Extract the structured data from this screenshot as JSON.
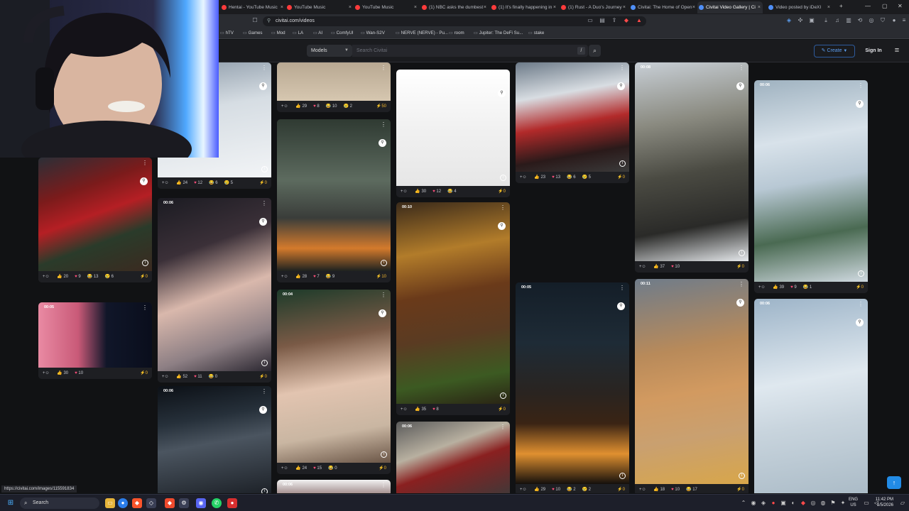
{
  "browser": {
    "tabs": [
      {
        "title": "Hentai - YouTube Music",
        "color": "#ff3b3b"
      },
      {
        "title": "YouTube Music",
        "color": "#ff3b3b"
      },
      {
        "title": "YouTube Music",
        "color": "#ff3b3b"
      },
      {
        "title": "(1) NBC asks the dumbest",
        "color": "#ff3b3b"
      },
      {
        "title": "(1) It's finally happening in",
        "color": "#ff3b3b"
      },
      {
        "title": "(1) Rust - A Duo's Journey",
        "color": "#ff3b3b"
      },
      {
        "title": "Civitai: The Home of Open",
        "color": "#4f8ff7"
      },
      {
        "title": "Civitai Video Gallery | Ci",
        "color": "#4f8ff7",
        "active": true
      },
      {
        "title": "Video posted by iDeXI",
        "color": "#4f8ff7"
      }
    ],
    "url": "civitai.com/videos",
    "bookmarks": [
      "hTV",
      "Games",
      "Mod",
      "LA",
      "AI",
      "ComfyUI",
      "Wan-S2V",
      "NERVE (NERVE) - Pu...",
      "room",
      "Jupiter: The DeFi Su...",
      "stake"
    ],
    "status_url": "https://civitai.com/images/115591834"
  },
  "site": {
    "model_select": "Models",
    "search_placeholder": "Search Civitai",
    "search_shortcut": "/",
    "create_label": "Create",
    "signin_label": "Sign In"
  },
  "cards": [
    {
      "id": "c1",
      "dur": "",
      "likes": "20",
      "hearts": "9",
      "laugh": "13",
      "cry": "6",
      "buzz": "0",
      "bg": "linear-gradient(160deg,#2b2f37 0%,#7b1b1b 30%,#b51f24 50%,#2a3b2a 70%,#3b2a20 100%)"
    },
    {
      "id": "c2",
      "dur": "00:05",
      "likes": "30",
      "hearts": "10",
      "laugh": "",
      "cry": "",
      "buzz": "0",
      "bg": "linear-gradient(90deg,#e98aa3 0%,#c95a78 35%,#101629 60%,#0a0e1c 100%)"
    },
    {
      "id": "c3",
      "dur": "",
      "likes": "24",
      "hearts": "12",
      "laugh": "6",
      "cry": "5",
      "buzz": "0",
      "bg": "linear-gradient(170deg,#8c9aa8 0%,#d6dde3 40%,#f2f4f6 100%)"
    },
    {
      "id": "c4",
      "dur": "00:06",
      "likes": "52",
      "hearts": "11",
      "laugh": "0",
      "cry": "",
      "buzz": "0",
      "bg": "linear-gradient(160deg,#1b1b22 0%,#3b3038 30%,#d9b8ac 55%,#8d7f84 80%,#2a2630 100%)"
    },
    {
      "id": "c5",
      "dur": "00:06",
      "likes": "",
      "hearts": "",
      "laugh": "",
      "cry": "",
      "buzz": "",
      "bg": "linear-gradient(170deg,#0c1016 0%,#26303a 30%,#4b5560 50%,#181c22 100%)"
    },
    {
      "id": "c6",
      "dur": "",
      "likes": "29",
      "hearts": "8",
      "laugh": "10",
      "cry": "2",
      "buzz": "50",
      "bg": "linear-gradient(180deg,#b8a892 0%,#d6c7b0 100%)"
    },
    {
      "id": "c7",
      "dur": "",
      "likes": "28",
      "hearts": "7",
      "laugh": "9",
      "cry": "",
      "buzz": "10",
      "bg": "linear-gradient(180deg,#2f3a32 0%,#5d6b5f 40%,#3a3d3a 65%,#d47a2c 85%,#1e2220 100%)"
    },
    {
      "id": "c8",
      "dur": "00:04",
      "likes": "24",
      "hearts": "15",
      "laugh": "0",
      "cry": "",
      "buzz": "0",
      "bg": "linear-gradient(170deg,#1d3b2a 0%,#7a5a46 30%,#e2c4b0 55%,#c9b6a2 80%,#6a5546 100%)"
    },
    {
      "id": "c9",
      "dur": "00:06",
      "likes": "",
      "hearts": "",
      "laugh": "",
      "cry": "",
      "buzz": "",
      "bg": "linear-gradient(180deg,#f2f2f2 0%,#7a5a5a 100%)"
    },
    {
      "id": "c10",
      "dur": "",
      "likes": "30",
      "hearts": "12",
      "laugh": "4",
      "cry": "",
      "buzz": "0",
      "bg": "linear-gradient(180deg,#ffffff 0%,#f1f1f1 50%,#e6e6e6 100%)"
    },
    {
      "id": "c11",
      "dur": "00:10",
      "likes": "35",
      "hearts": "8",
      "laugh": "",
      "cry": "",
      "buzz": "0",
      "bg": "linear-gradient(170deg,#3a2a1a 0%,#b27c2a 25%,#6a3a1a 45%,#5a3b22 65%,#3c5a22 85%,#2a2414 100%)"
    },
    {
      "id": "c12",
      "dur": "00:06",
      "likes": "",
      "hearts": "",
      "laugh": "",
      "cry": "",
      "buzz": "",
      "bg": "linear-gradient(160deg,#5a5a5a 0%,#b8b0a0 35%,#8a2020 55%,#3a3a3a 100%)"
    },
    {
      "id": "c13",
      "dur": "",
      "likes": "23",
      "hearts": "13",
      "laugh": "6",
      "cry": "5",
      "buzz": "0",
      "bg": "linear-gradient(170deg,#6c7a88 0%,#d8dde2 30%,#b22a2a 55%,#2a1a1a 80%,#3a3a3a 100%)"
    },
    {
      "id": "c14",
      "dur": "00:05",
      "likes": "29",
      "hearts": "10",
      "laugh": "2",
      "cry": "2",
      "buzz": "0",
      "bg": "linear-gradient(180deg,#141e28 0%,#1e2b36 30%,#2a2420 55%,#3a2414 70%,#e09030 85%,#140f0c 100%)"
    },
    {
      "id": "c15",
      "dur": "00:08",
      "likes": "37",
      "hearts": "10",
      "laugh": "",
      "cry": "",
      "buzz": "0",
      "bg": "linear-gradient(170deg,#c8cfd6 0%,#8a8a80 30%,#4a4a42 55%,#2a2a28 80%,#e6e9ec 100%)"
    },
    {
      "id": "c16",
      "dur": "00:11",
      "likes": "18",
      "hearts": "10",
      "laugh": "17",
      "cry": "",
      "buzz": "0",
      "bg": "linear-gradient(170deg,#6f7c8a 0%,#b88a5a 35%,#d29a60 55%,#c9a070 75%,#d8a64a 100%)"
    },
    {
      "id": "c17",
      "dur": "00:06",
      "likes": "39",
      "hearts": "9",
      "laugh": "1",
      "cry": "",
      "buzz": "0",
      "bg": "linear-gradient(170deg,#9fb2c0 0%,#d8e2ea 30%,#b8c8d4 50%,#4a6a52 75%,#cfd9e0 100%)"
    },
    {
      "id": "c18",
      "dur": "00:06",
      "likes": "",
      "hearts": "",
      "laugh": "",
      "cry": "",
      "buzz": "",
      "bg": "linear-gradient(170deg,#9db4c8 0%,#dfe8ef 40%,#c8d4dd 60%,#a7b8c4 100%)"
    }
  ],
  "taskbar": {
    "search_label": "Search",
    "lang_line1": "ENG",
    "lang_line2": "US",
    "time": "11:42 PM",
    "date": "1/5/2026"
  }
}
